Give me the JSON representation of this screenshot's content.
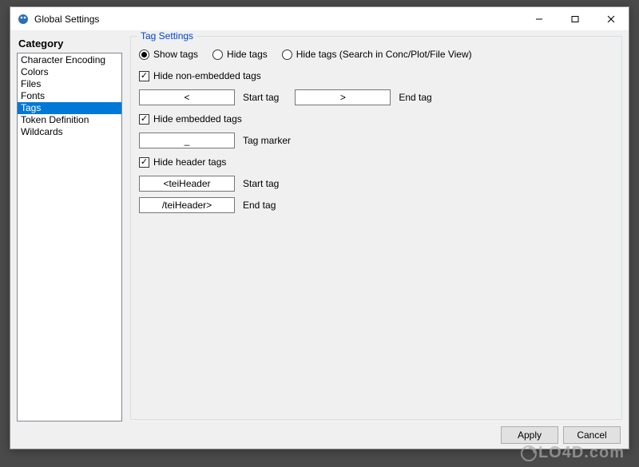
{
  "window": {
    "title": "Global Settings"
  },
  "sidebar": {
    "header": "Category",
    "items": [
      {
        "label": "Character Encoding",
        "selected": false
      },
      {
        "label": "Colors",
        "selected": false
      },
      {
        "label": "Files",
        "selected": false
      },
      {
        "label": "Fonts",
        "selected": false
      },
      {
        "label": "Tags",
        "selected": true
      },
      {
        "label": "Token Definition",
        "selected": false
      },
      {
        "label": "Wildcards",
        "selected": false
      }
    ]
  },
  "panel": {
    "title": "Tag Settings",
    "radios": {
      "show": "Show tags",
      "hide": "Hide tags",
      "hide_search": "Hide tags (Search in Conc/Plot/File View)"
    },
    "hide_non_embedded": {
      "label": "Hide non-embedded tags",
      "start_value": "<",
      "start_label": "Start tag",
      "end_value": ">",
      "end_label": "End tag"
    },
    "hide_embedded": {
      "label": "Hide embedded tags",
      "marker_value": "_",
      "marker_label": "Tag marker"
    },
    "hide_header": {
      "label": "Hide header tags",
      "start_value": "<teiHeader",
      "start_label": "Start tag",
      "end_value": "/teiHeader>",
      "end_label": "End tag"
    }
  },
  "footer": {
    "apply": "Apply",
    "cancel": "Cancel"
  },
  "watermark": "LO4D.com"
}
